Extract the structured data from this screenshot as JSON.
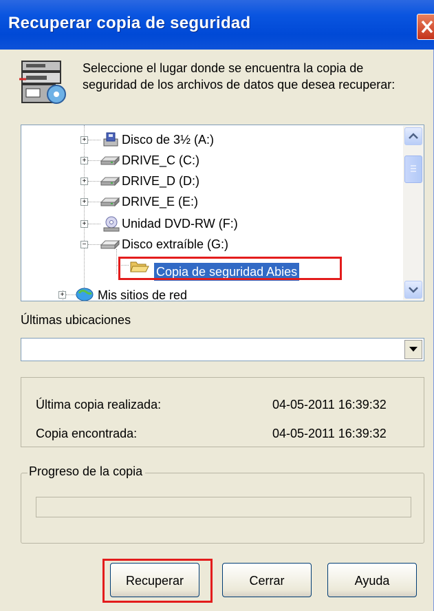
{
  "window": {
    "title": "Recuperar copia de seguridad"
  },
  "instructions": "Seleccione el lugar donde se encuentra la copia de seguridad de los archivos de datos que desea recuperar:",
  "tree": {
    "items": [
      {
        "label": "Disco de 3½ (A:)",
        "icon": "floppy-drive-icon",
        "expander": "+"
      },
      {
        "label": "DRIVE_C (C:)",
        "icon": "hard-drive-icon",
        "expander": "+"
      },
      {
        "label": "DRIVE_D (D:)",
        "icon": "hard-drive-icon",
        "expander": "+"
      },
      {
        "label": "DRIVE_E (E:)",
        "icon": "hard-drive-icon",
        "expander": "+"
      },
      {
        "label": "Unidad DVD-RW (F:)",
        "icon": "dvd-drive-icon",
        "expander": "+"
      },
      {
        "label": "Disco extraíble (G:)",
        "icon": "removable-drive-icon",
        "expander": "−"
      },
      {
        "label": "Copia de seguridad Abies",
        "icon": "folder-open-icon",
        "selected": true
      },
      {
        "label": "Mis sitios de red",
        "icon": "network-places-icon",
        "expander": "+"
      }
    ]
  },
  "last_locations": {
    "label": "Últimas ubicaciones",
    "value": ""
  },
  "info": {
    "last_copy_label": "Última copia realizada:",
    "last_copy_value": "04-05-2011 16:39:32",
    "found_copy_label": "Copia encontrada:",
    "found_copy_value": "04-05-2011 16:39:32"
  },
  "progress": {
    "legend": "Progreso de la copia",
    "fraction": 0
  },
  "buttons": {
    "recover": "Recuperar",
    "close": "Cerrar",
    "help": "Ayuda"
  },
  "colors": {
    "titlebar": "#0a55e0",
    "selection": "#316ac5",
    "highlight_box": "#e31c1c",
    "window_bg": "#ece9d8"
  }
}
